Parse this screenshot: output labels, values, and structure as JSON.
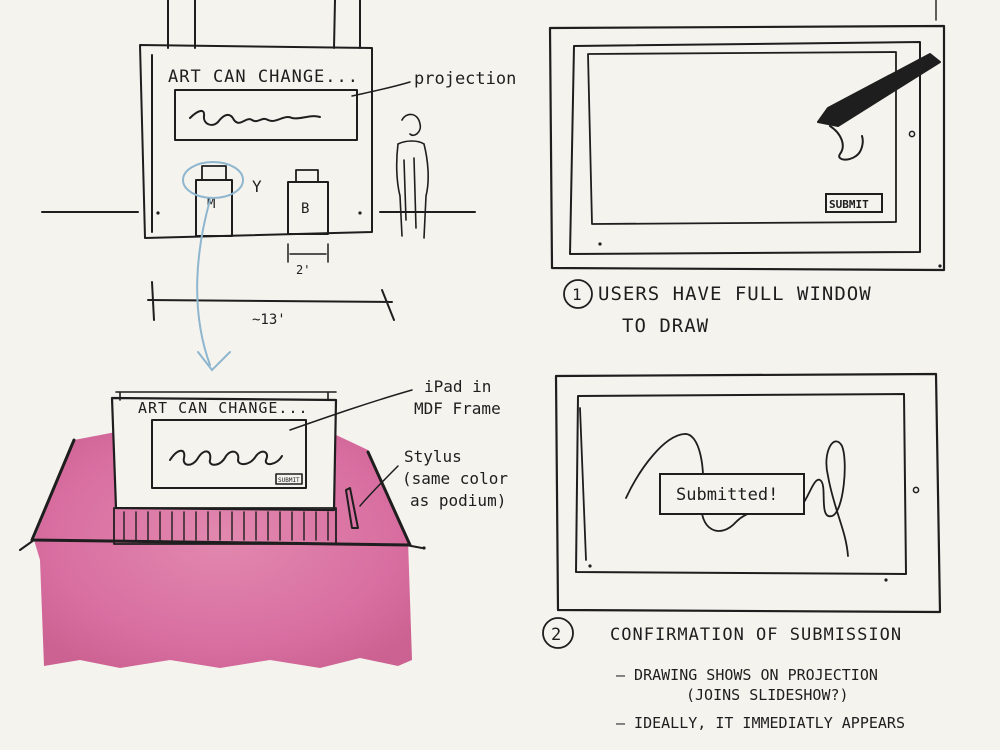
{
  "sketch_left": {
    "wall_banner": "ART CAN CHANGE...",
    "projection_label": "projection",
    "podium_m": "M",
    "podium_b": "B",
    "podium_y": "Y",
    "podium_width": "2'",
    "wall_width": "~13'"
  },
  "podium_detail": {
    "banner": "ART CAN CHANGE...",
    "button": "SUBMIT",
    "ipad_label_line1": "iPad in",
    "ipad_label_line2": "MDF Frame",
    "stylus_line1": "Stylus",
    "stylus_line2": "(same color",
    "stylus_line3": "as podium)",
    "colors": {
      "podium_fill": "#d8689a",
      "ink": "#1e1e1e",
      "arrow": "#8fb6cf",
      "paper": "#f4f3ee"
    }
  },
  "screen1": {
    "number": "1",
    "submit_button": "SUBMIT",
    "caption_line1": "USERS HAVE FULL WINDOW",
    "caption_line2": "TO DRAW"
  },
  "screen2": {
    "number": "2",
    "confirmation": "Submitted!",
    "caption": "CONFIRMATION OF SUBMISSION",
    "bullet1_line1": "— DRAWING SHOWS ON PROJECTION",
    "bullet1_line2": "(JOINS SLIDESHOW?)",
    "bullet2": "— IDEALLY, IT IMMEDIATLY APPEARS"
  }
}
